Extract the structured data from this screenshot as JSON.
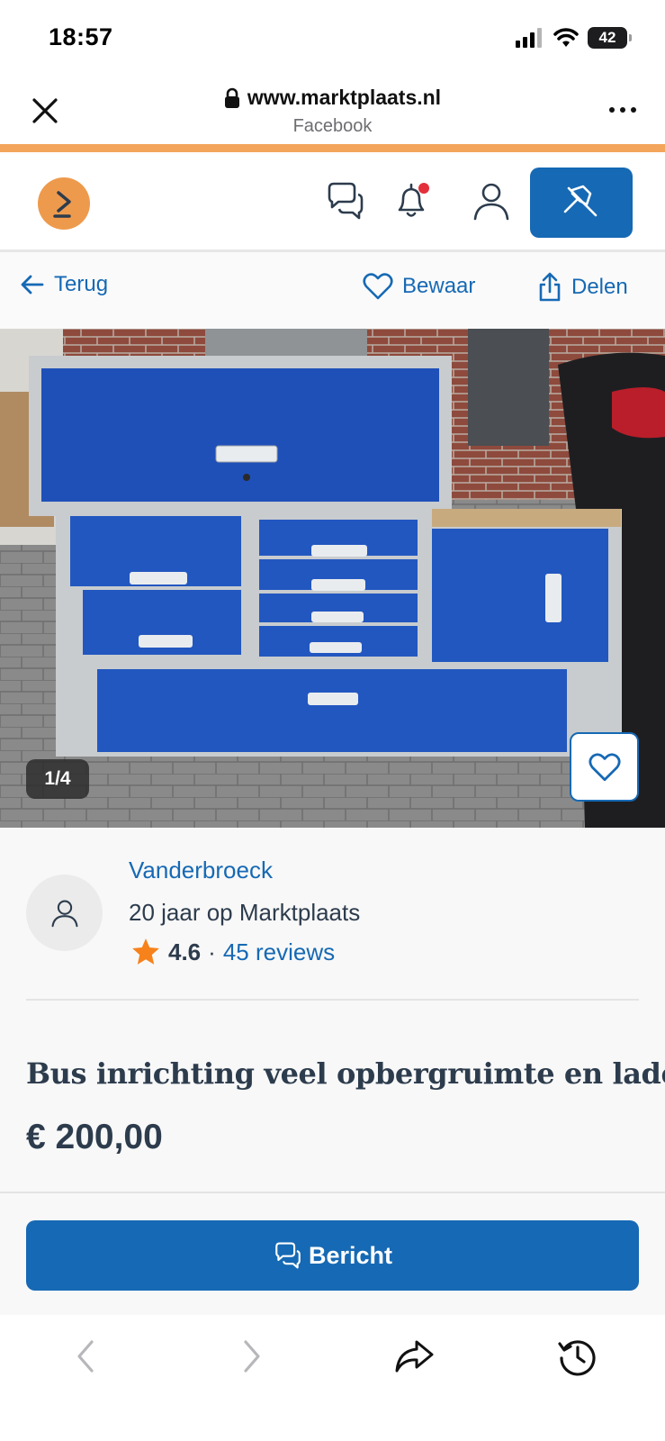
{
  "status_bar": {
    "time": "18:57",
    "battery": "42",
    "icons": [
      "cellular-signal-icon",
      "wifi-icon",
      "battery-icon"
    ]
  },
  "browser": {
    "url": "www.marktplaats.nl",
    "subtitle": "Facebook",
    "icons": [
      "close-icon",
      "lock-icon",
      "more-icon"
    ]
  },
  "header": {
    "icons": [
      "marktplaats-logo",
      "chat-icon",
      "bell-icon",
      "user-icon",
      "pin-icon"
    ],
    "notification_color": "#e3303b",
    "accent": "#1669b4"
  },
  "actions": {
    "back": "Terug",
    "save": "Bewaar",
    "share": "Delen"
  },
  "photo": {
    "counter": "1/4",
    "icons": [
      "heart-icon"
    ]
  },
  "seller": {
    "name": "Vanderbroeck",
    "years": "20 jaar op Marktplaats",
    "rating": "4.6",
    "separator": "·",
    "reviews": "45 reviews",
    "star_color": "#f7821b"
  },
  "listing": {
    "title": "Bus inrichting veel opbergruimte en lades",
    "price": "€ 200,00"
  },
  "cta": {
    "label": "Bericht"
  },
  "bottom_nav": {
    "icons": [
      "back-arrow-icon",
      "forward-arrow-icon",
      "share-arrow-icon",
      "history-icon"
    ]
  }
}
